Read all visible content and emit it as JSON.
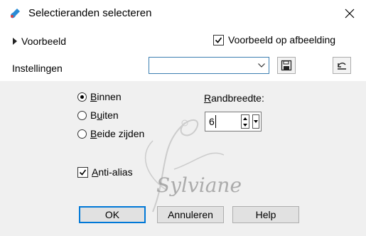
{
  "window": {
    "title": "Selectieranden selecteren",
    "icon": "paint-brush-icon",
    "close_icon": "close-icon"
  },
  "header": {
    "preview_label": "Voorbeeld",
    "preview_on_image_label": "Voorbeeld op afbeelding",
    "preview_on_image_checked": true,
    "settings_label": "Instellingen",
    "settings_value": ""
  },
  "options": {
    "radios": [
      {
        "prefix": "",
        "key": "B",
        "rest": "innen",
        "checked": true
      },
      {
        "prefix": "",
        "key": "B",
        "rest": "uiten",
        "checked": false
      },
      {
        "prefix": "",
        "key": "B",
        "rest": "eide zijden",
        "checked": false
      }
    ],
    "antialias_key": "A",
    "antialias_rest": "nti-alias",
    "antialias_checked": true,
    "border_width_key": "R",
    "border_width_rest": "andbreedte:",
    "border_width_value": "6"
  },
  "watermark": {
    "text": "Sylviane"
  },
  "buttons": {
    "ok": "OK",
    "cancel": "Annuleren",
    "help": "Help"
  },
  "colors": {
    "panel_bg": "#f0f0f0",
    "focus_blue": "#0078d7"
  }
}
